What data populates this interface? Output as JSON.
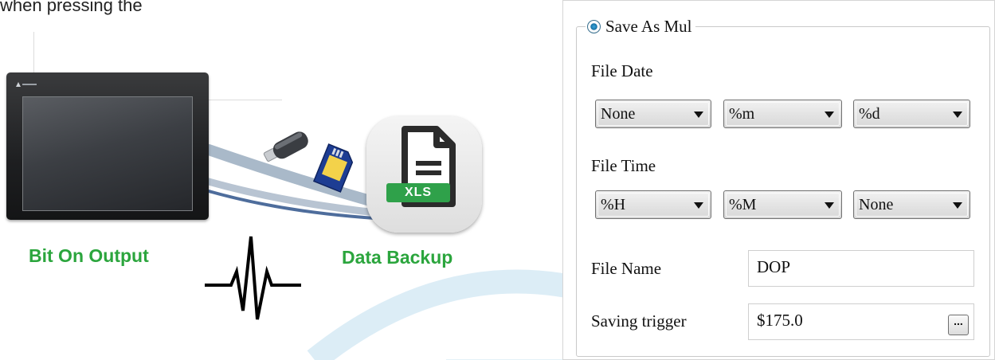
{
  "illustration": {
    "top_caption": "when pressing the",
    "bit_on_label": "Bit On Output",
    "backup_label": "Data Backup",
    "xls_badge": "XLS",
    "colors": {
      "green_label": "#2ba53d",
      "xls_badge": "#2fa14a",
      "cable_gray": "#9fb2c6",
      "cable_blue": "#4a6a9a",
      "bg_arc": "#dbeef7"
    }
  },
  "dialog": {
    "mode_radio": {
      "label": "Save As Mul",
      "selected": true
    },
    "file_date": {
      "label": "File Date",
      "combos": [
        "None",
        "%m",
        "%d"
      ]
    },
    "file_time": {
      "label": "File Time",
      "combos": [
        "%H",
        "%M",
        "None"
      ]
    },
    "file_name": {
      "label": "File Name",
      "value": "DOP"
    },
    "saving_trigger": {
      "label": "Saving trigger",
      "value": "$175.0",
      "browse_label": "..."
    }
  }
}
